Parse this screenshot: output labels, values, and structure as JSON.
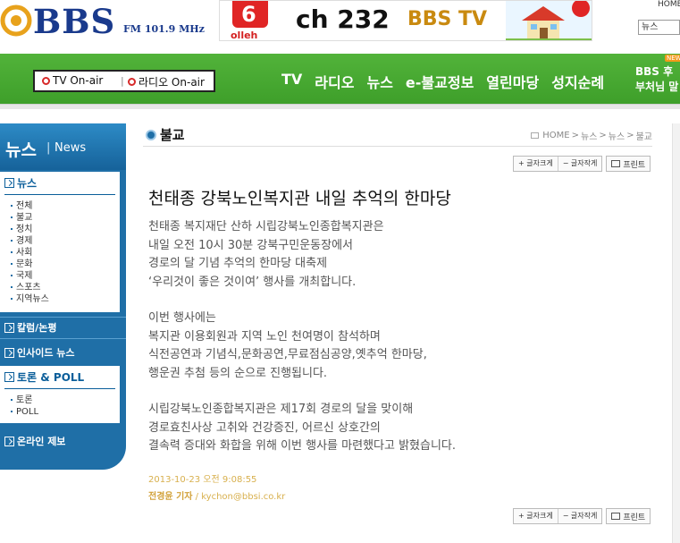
{
  "header": {
    "logo_text": "BBS",
    "logo_freq": "FM 101.9 MHz",
    "banner": {
      "brand": "6",
      "brand_caption": "olleh",
      "channel": "ch 232",
      "channel_name": "BBS TV"
    },
    "home_link": "HOME",
    "site_select": "뉴스"
  },
  "nav": {
    "onair_tv": "TV On-air",
    "onair_radio": "라디오 On-air",
    "onair_sep": "|",
    "menu": [
      "TV",
      "라디오",
      "뉴스",
      "e-불교정보",
      "열린마당",
      "성지순례"
    ],
    "extra_line1": "BBS 후",
    "extra_line2": "부처님 말",
    "new_badge": "NEW"
  },
  "sidebar": {
    "head_ko": "뉴스",
    "head_sep": "|",
    "head_en": "News",
    "news_title": "뉴스",
    "news_items": [
      "전체",
      "불교",
      "정치",
      "경제",
      "사회",
      "문화",
      "국제",
      "스포츠",
      "지역뉴스"
    ],
    "link_column": "칼럼/논평",
    "link_inside": "인사이드 뉴스",
    "poll_title": "토론 & POLL",
    "poll_items": [
      "토론",
      "POLL"
    ],
    "link_report": "온라인 제보"
  },
  "article": {
    "section": "불교",
    "breadcrumb": [
      "HOME",
      ">",
      "뉴스",
      ">",
      "뉴스",
      ">",
      "불교"
    ],
    "tools": {
      "bigger": "+ 글자크게",
      "smaller": "− 글자작게",
      "print": "프린트"
    },
    "headline": "천태종 강북노인복지관 내일 추억의 한마당",
    "paragraphs": [
      [
        "천태종 복지재단 산하 시립강북노인종합복지관은",
        "내일 오전 10시 30분 강북구민운동장에서",
        "경로의 달 기념 추억의 한마당 대축제",
        "‘우리것이 좋은 것이여’ 행사를 개최합니다."
      ],
      [
        "이번 행사에는",
        "복지관 이용회원과 지역 노인 천여명이 참석하며",
        "식전공연과 기념식,문화공연,무료점심공양,옛추억 한마당,",
        "행운권 추첨 등의 순으로 진행됩니다."
      ],
      [
        "시립강북노인종합복지관은 제17회 경로의 달을 맞이해",
        "경로효친사상 고취와 건강증진, 어르신 상호간의",
        "결속력 증대와 화합을 위해 이번 행사를 마련했다고 밝혔습니다."
      ]
    ],
    "date": "2013-10-23 오전 9:08:55",
    "writer": "전경윤 기자",
    "writer_sep": "/",
    "email": "kychon@bbsi.co.kr"
  },
  "colors": {
    "brand_blue": "#1a3a8c",
    "nav_green": "#4aab34",
    "sidebar_blue": "#1f6fa7",
    "meta_gold": "#d8b04e"
  }
}
